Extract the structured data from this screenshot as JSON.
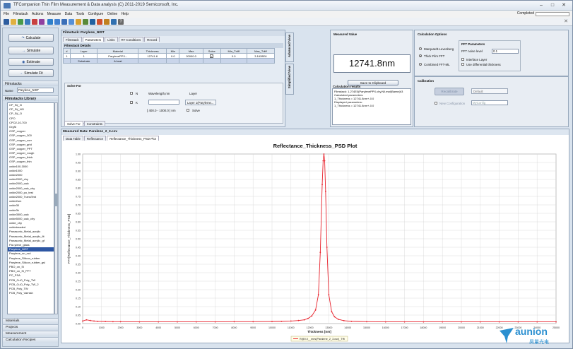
{
  "window": {
    "title": "TFCompanion Thin Film Measurement & Data analysis (C) 2011-2019 Semiconsoft, Inc."
  },
  "menu": [
    "File",
    "Filmstack",
    "Actions",
    "Measure",
    "Data",
    "Tools",
    "Configure",
    "Online",
    "Help"
  ],
  "status": {
    "completed": "Completed"
  },
  "left": {
    "buttons": [
      "Calculate",
      "Simulate",
      "Estimate",
      "Simulate Fit"
    ],
    "filmstacks_header": "Filmstacks",
    "name_label": "Name",
    "name_value": "Parylene_NIST",
    "library_header": "Filmstacks Library",
    "library": [
      "CP_Si(_N",
      "CP_Si(_NO",
      "CP_Si(_O",
      "CPO",
      "CPO2-10-700",
      "OrgSi",
      "OSP_copper",
      "OSP_copper_300",
      "OSP_copper_corr",
      "OSP_copper_grid",
      "OSP_copper_PPT",
      "OSP_copper_rough",
      "OSP_copper_thick",
      "OSP_copper_thin",
      "oxide100-3000",
      "oxide1000",
      "oxide2000",
      "oxide2000_chy",
      "oxide2000_calc",
      "oxide2000_calc_chy",
      "oxide2000_po_test",
      "oxide2000_TransTest",
      "oxide2um",
      "oxide30",
      "oxide3k",
      "oxide3500_calc",
      "oxide5000_calc_chy",
      "oxide_chy",
      "oxidetreaded",
      "Panasonic_Metal_acrylic",
      "Panasonic_Metal_acrylic_fit",
      "Panasonic_Metal_acrylic_gf",
      "Par-ylene_glass",
      "Parylene_NIST",
      "Parylene_on_rod",
      "Parylene_Silicon_rubber",
      "Parylene_Silicon_rubber_gsl",
      "PBO_on_Si",
      "PBO_on_Si_PFT",
      "PC_PSA",
      "PCB_CuO_Poly_TW",
      "PCB_CuO_Poly_TW_2",
      "PCB_Poly_TW",
      "PCB_Poly_Varnish"
    ],
    "selected": "Parylene_NIST",
    "bottom_tabs": [
      "Materials",
      "Projects",
      "Measurement",
      "Calculation Recipes"
    ]
  },
  "filmstack": {
    "header": "Filmstack: Parylene_NIST",
    "tabs": [
      "Filmstack",
      "Parameters",
      "Links",
      "RT Conditions",
      "Record"
    ],
    "details_header": "Filmstack Details",
    "columns": [
      "#",
      "Layer",
      "Material",
      "Thickness",
      "Min",
      "Max",
      "Solve",
      "Min_Tdiff",
      "Max_Tdiff"
    ],
    "rows": [
      [
        "1",
        "1",
        "ParylenePPX...",
        "12741.8",
        "0.0",
        "20000.0",
        "checked",
        "0.0",
        "3.1628E6"
      ],
      [
        "",
        "Substrate",
        "Al.mat",
        "",
        "",
        "",
        "",
        "",
        ""
      ]
    ],
    "solvefor": {
      "title": "Solve For",
      "n": "N",
      "k": "K",
      "wavelength": "Wavelength,nm",
      "layer": "Layer",
      "layer_value": "Layer 1(Paryleme...",
      "range": "[ 400.0 - 1000.0 ] nm",
      "solve": "Solve"
    },
    "bottom_tabs": [
      "Solve For",
      "Constraints"
    ]
  },
  "side_tabs": [
    "Advanced View",
    "Simplified View"
  ],
  "measured": {
    "header": "Measured Value",
    "value": "12741.8nm",
    "save": "Save to Clipboard",
    "results_header": "Calculation results",
    "results": [
      "Filmstack: 1.274E0(ParylenePPX.chy,Nil.mat)Bame(#3",
      "Calculated parameters:",
      "1_Thickness = 12741.8nm+-0.0",
      "Displayed parameters:",
      "1_Thickness = 12741.8nm+-0.0"
    ]
  },
  "calc_options": {
    "header": "Calculation Options",
    "methods": [
      "Marquardt-Levenberg",
      "Thick Film FFT",
      "Combined FFT-ML"
    ],
    "selected": "Thick Film FFT",
    "fft_header": "FFT Parameters",
    "noise_label": "FFT noise level",
    "noise_value": "0.1",
    "interface": "Interface Layer",
    "differential": "Use differential thickness"
  },
  "calibration": {
    "header": "Calibration",
    "button": "Recalibrate",
    "default": "Default",
    "new_config": "New Configuration",
    "config_placeholder": "MyConfig"
  },
  "plot": {
    "header": "Measured Data: Paralene_2_3.csv",
    "tabs": [
      "Data Table",
      "Reflectance",
      "Reflectance_Thickness_PSD Plot"
    ]
  },
  "chart_data": {
    "type": "line",
    "title": "Reflectance_Thickness_PSD Plot",
    "xlabel": "Thickness [nm]",
    "ylabel": "FFT[Reflectance_Thickness_PSD]",
    "xlim": [
      0,
      25000
    ],
    "ylim": [
      0,
      1.0
    ],
    "xticks": [
      0,
      1000,
      2000,
      3000,
      4000,
      5000,
      6000,
      7000,
      8000,
      9000,
      10000,
      11000,
      12000,
      13000,
      14000,
      15000,
      16000,
      17000,
      18000,
      19000,
      20000,
      21000,
      22000,
      23000,
      24000,
      25000
    ],
    "yticks": [
      0,
      0.05,
      0.1,
      0.15,
      0.2,
      0.25,
      0.3,
      0.35,
      0.4,
      0.45,
      0.5,
      0.55,
      0.6,
      0.65,
      0.7,
      0.75,
      0.8,
      0.85,
      0.9,
      0.95,
      1.0
    ],
    "series": [
      {
        "name": "R@0.0__mes(Paralene_2_3.csv)_Tfft",
        "x": [
          0,
          200,
          400,
          600,
          800,
          1200,
          1600,
          2000,
          3000,
          4000,
          5000,
          6000,
          7000,
          8000,
          9000,
          10000,
          10500,
          11000,
          11400,
          11700,
          11900,
          12100,
          12300,
          12450,
          12550,
          12650,
          12700,
          12741,
          12780,
          12830,
          12900,
          13000,
          13150,
          13300,
          13500,
          13800,
          14200,
          15000,
          16000,
          17000,
          18000,
          19000,
          20000,
          21000,
          22000,
          23000,
          24000,
          25000
        ],
        "values": [
          0.015,
          0.022,
          0.018,
          0.015,
          0.013,
          0.012,
          0.011,
          0.011,
          0.01,
          0.01,
          0.01,
          0.01,
          0.01,
          0.011,
          0.011,
          0.012,
          0.013,
          0.015,
          0.018,
          0.022,
          0.03,
          0.045,
          0.08,
          0.17,
          0.42,
          0.82,
          0.96,
          1.0,
          0.96,
          0.78,
          0.45,
          0.17,
          0.07,
          0.04,
          0.025,
          0.017,
          0.013,
          0.011,
          0.01,
          0.01,
          0.01,
          0.01,
          0.01,
          0.01,
          0.01,
          0.01,
          0.01,
          0.01
        ],
        "color": "#e8202a"
      }
    ],
    "legend": "bottom-center"
  },
  "logo": {
    "text": "aunion",
    "sub": "昊量光电"
  },
  "colors": {
    "series": "#e8202a",
    "selection": "#2e57a3",
    "panel": "#d9e3ee"
  }
}
